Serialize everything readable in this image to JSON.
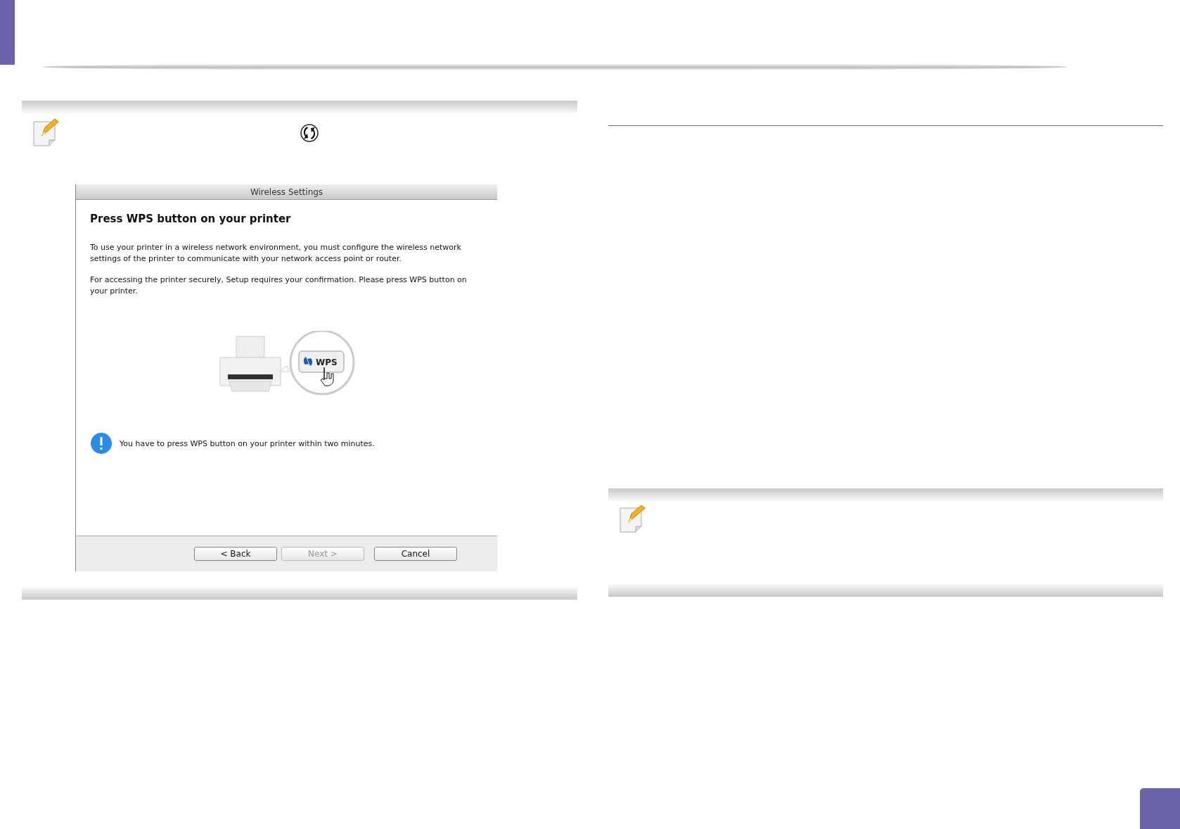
{
  "dialog": {
    "title": "Wireless Settings",
    "heading": "Press WPS button on your printer",
    "paragraphs": [
      "To use your printer in a wireless network environment, you must configure the wireless network settings of the printer to communicate with your network access point or router.",
      "For accessing the printer securely, Setup requires your confirmation. Please press WPS button on your printer."
    ],
    "illustration_label": "WPS",
    "info": "You have to press WPS button on your printer within two minutes.",
    "buttons": [
      {
        "label": "< Back",
        "disabled": false
      },
      {
        "label": "Next >",
        "disabled": true
      },
      {
        "label": "Cancel",
        "disabled": false
      }
    ]
  }
}
